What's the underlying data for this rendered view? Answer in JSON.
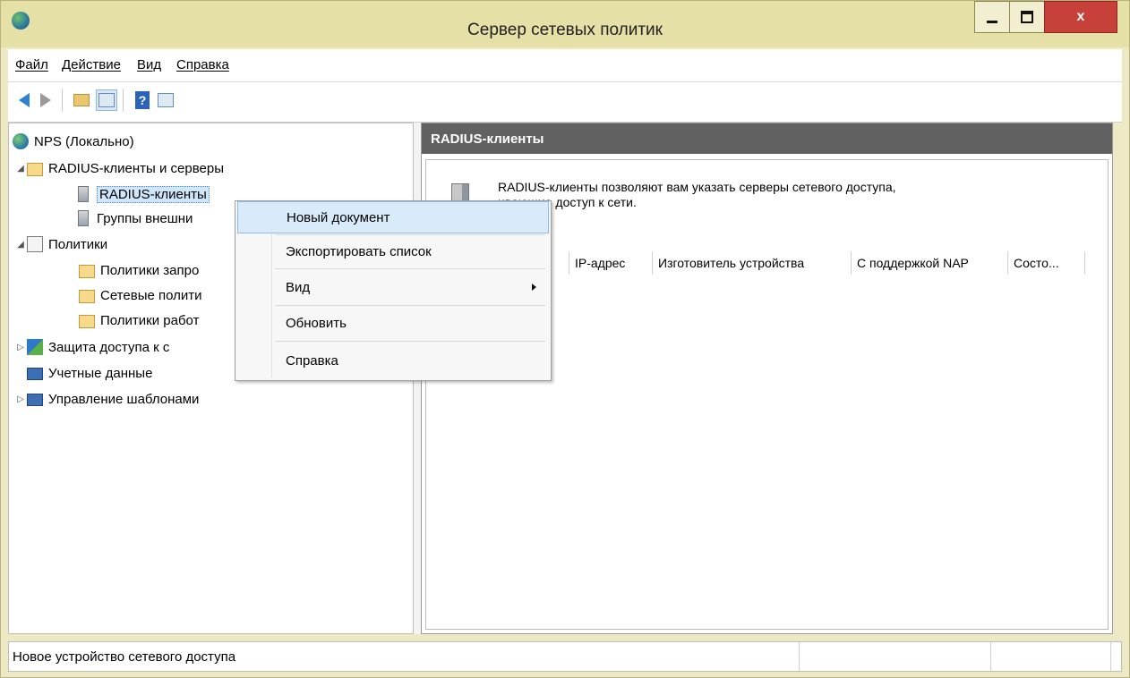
{
  "window": {
    "title": "Сервер сетевых политик",
    "close_glyph": "x"
  },
  "menu": [
    "Файл",
    "Действие",
    "Вид",
    "Справка"
  ],
  "tree": {
    "root": "NPS (Локально)",
    "radius_group": "RADIUS-клиенты и серверы",
    "radius_clients": "RADIUS-клиенты",
    "remote_groups": "Группы внешни",
    "policies": "Политики",
    "connection_policies": "Политики запро",
    "network_policies": "Сетевые полити",
    "health_policies": "Политики работ",
    "nap": "Защита доступа к с",
    "accounting": "Учетные данные",
    "templates": "Управление шаблонами"
  },
  "right_pane": {
    "header": "RADIUS-клиенты",
    "description_line1": "RADIUS-клиенты позволяют вам указать серверы сетевого доступа,",
    "description_line2": "ивающие доступ к сети.",
    "columns": [
      "IP-адрес",
      "Изготовитель устройства",
      "С поддержкой NAP",
      "Состо..."
    ]
  },
  "context_menu": {
    "items": [
      "Новый документ",
      "Экспортировать список",
      "Вид",
      "Обновить",
      "Справка"
    ],
    "highlighted": "Новый документ"
  },
  "status": {
    "text": "Новое устройство сетевого доступа"
  },
  "colors": {
    "title_bar": "#e5e0a5",
    "close_button": "#c7413a",
    "pane_header": "#616161",
    "selection": "#cfe6fb"
  }
}
